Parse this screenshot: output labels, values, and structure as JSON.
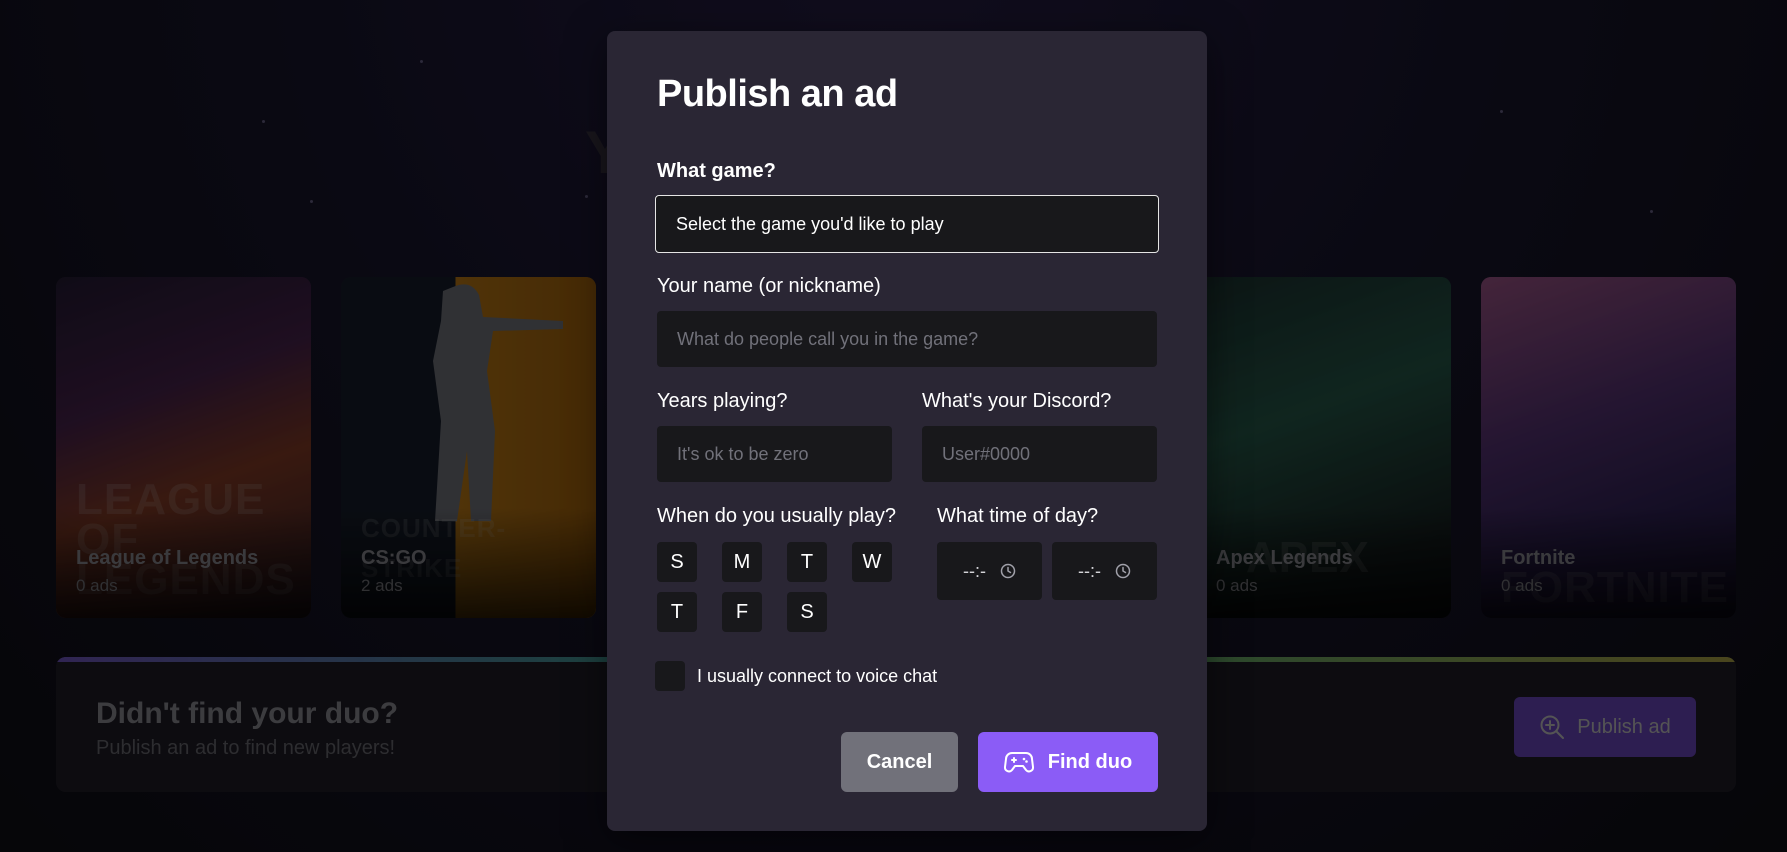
{
  "background": {
    "games": [
      {
        "title": "League of Legends",
        "count": "0 ads"
      },
      {
        "title": "CS:GO",
        "count": "2 ads"
      },
      {
        "title": "Apex Legends",
        "count": "0 ads"
      },
      {
        "title": "Fortnite",
        "count": "0 ads"
      }
    ],
    "banner": {
      "title": "Didn't find your duo?",
      "subtitle": "Publish an ad to find new players!",
      "button_label": "Publish ad"
    }
  },
  "modal": {
    "title": "Publish an ad",
    "game_label": "What game?",
    "game_select_value": "Select the game you'd like to play",
    "name_label": "Your name (or nickname)",
    "name_placeholder": "What do people call you in the game?",
    "years_label": "Years playing?",
    "years_placeholder": "It's ok to be zero",
    "discord_label": "What's your Discord?",
    "discord_placeholder": "User#0000",
    "days_label": "When do you usually play?",
    "days": [
      "S",
      "M",
      "T",
      "W",
      "T",
      "F",
      "S"
    ],
    "time_label": "What time of day?",
    "time_start_value": "--:-",
    "time_end_value": "--:-",
    "voice_label": "I usually connect to voice chat",
    "cancel_label": "Cancel",
    "submit_label": "Find duo"
  },
  "colors": {
    "accent": "#8b5cf6",
    "modal_bg": "#2a2634",
    "input_bg": "#18181b",
    "cancel_bg": "#71717a"
  }
}
